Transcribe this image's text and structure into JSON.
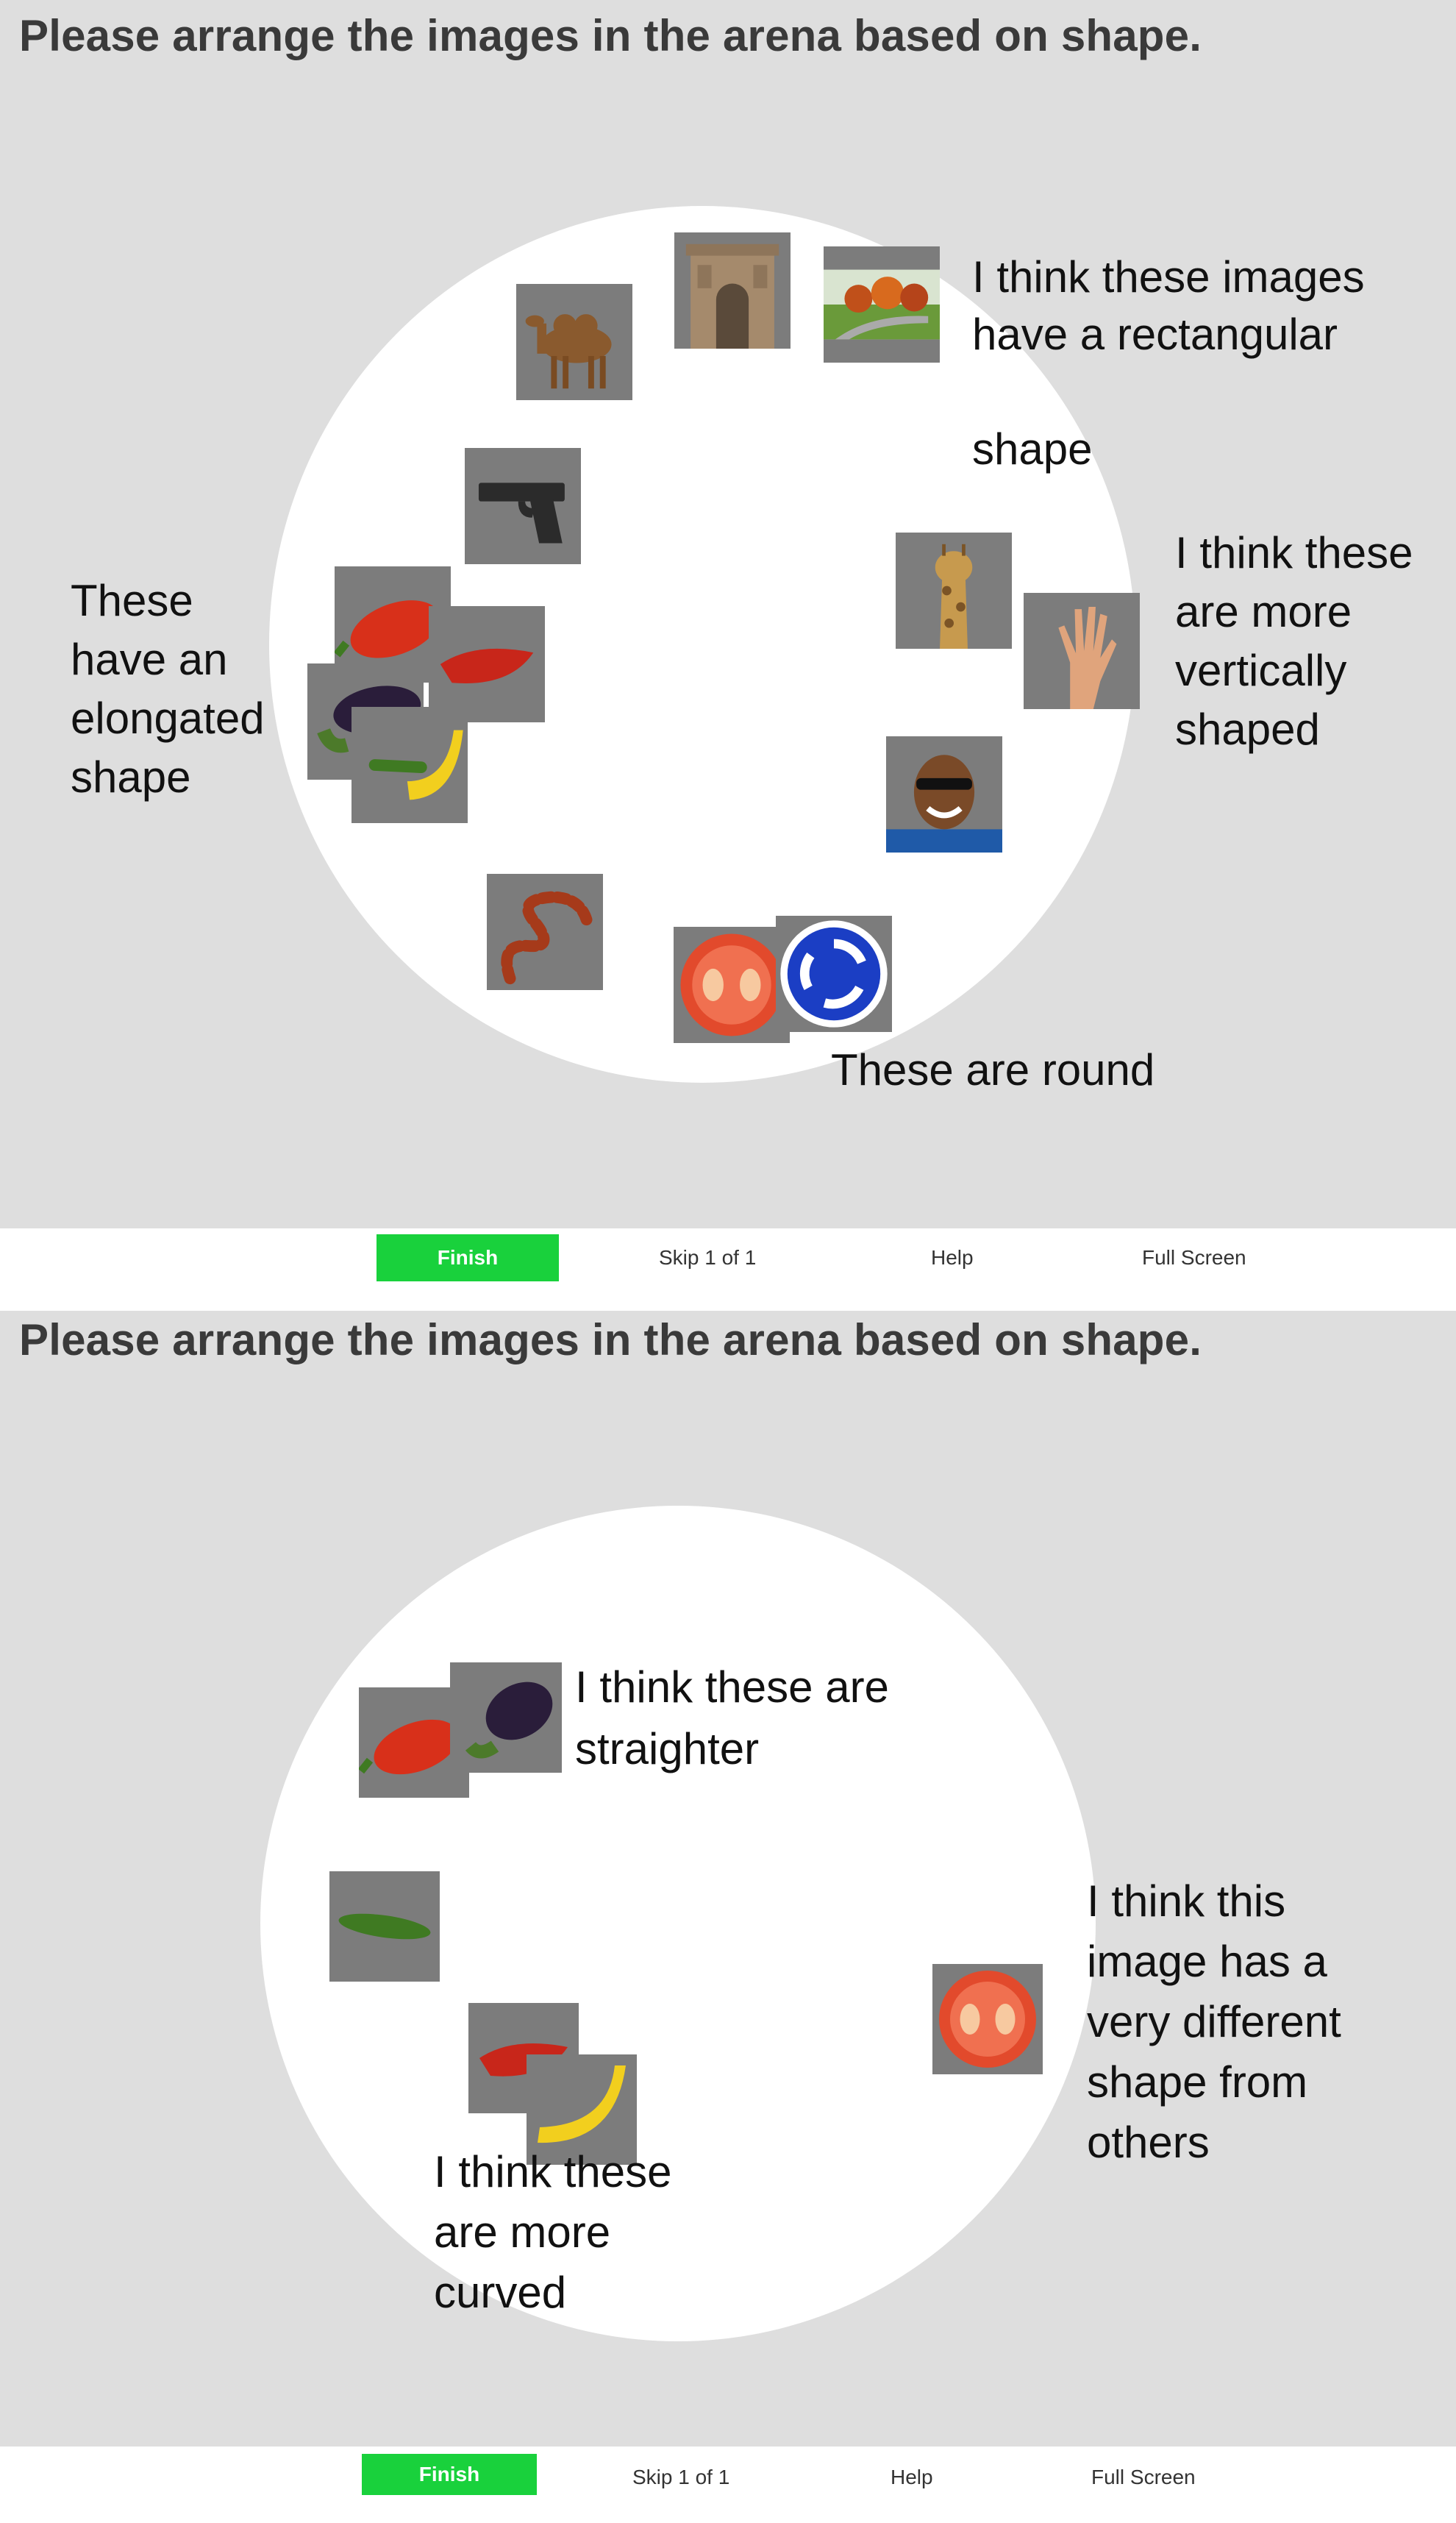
{
  "screens": [
    {
      "prompt": "Please arrange the images in the arena based on shape.",
      "notes": {
        "rectangular": "I think these images\nhave a rectangular\n\nshape",
        "vertical": "I think these\nare more\nvertically\nshaped",
        "elongated": "These\nhave an\nelongated\nshape",
        "round": "These are round"
      },
      "footer": {
        "finish": "Finish",
        "skip": "Skip 1 of 1",
        "help": "Help",
        "fullscreen": "Full Screen"
      }
    },
    {
      "prompt": "Please arrange the images in the arena based on shape.",
      "notes": {
        "straighter": "I think these are\nstraighter",
        "different": "I think this\nimage has a\nvery different\nshape from\nothers",
        "curved": "I think these\nare more\ncurved"
      },
      "footer": {
        "finish": "Finish",
        "skip": "Skip 1 of 1",
        "help": "Help",
        "fullscreen": "Full Screen"
      }
    }
  ],
  "colors": {
    "finish_green": "#19d13c",
    "arena_bg": "#ffffff",
    "page_bg": "#dedede",
    "thumb_bg": "#7c7c7c"
  },
  "thumbnail_subjects": [
    "camel",
    "arch",
    "landscape",
    "pistol",
    "giraffe",
    "hand",
    "face",
    "red-pepper",
    "chili",
    "eggplant",
    "zucchini",
    "banana",
    "snake",
    "tomato",
    "roundabout-sign"
  ]
}
